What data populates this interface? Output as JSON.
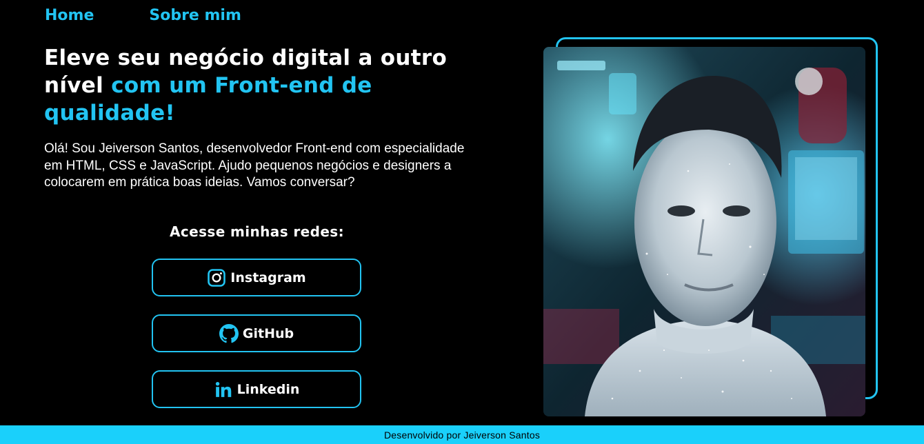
{
  "nav": {
    "home": "Home",
    "about": "Sobre mim"
  },
  "hero": {
    "headline_plain": "Eleve seu negócio digital a outro nível",
    "headline_accent": "com um Front-end de qualidade!",
    "intro": "Olá! Sou Jeiverson Santos, desenvolvedor Front-end com especialidade em HTML, CSS e JavaScript. Ajudo pequenos negócios e designers a colocarem em prática boas ideias. Vamos conversar?"
  },
  "social": {
    "title": "Acesse minhas redes:",
    "buttons": [
      {
        "label": "Instagram",
        "icon": "instagram-icon"
      },
      {
        "label": "GitHub",
        "icon": "github-icon"
      },
      {
        "label": "Linkedin",
        "icon": "linkedin-icon"
      }
    ]
  },
  "footer": {
    "text": "Desenvolvido por Jeiverson Santos"
  },
  "colors": {
    "accent": "#22c4f2",
    "background": "#000000",
    "footer": "#1ad0fb"
  }
}
